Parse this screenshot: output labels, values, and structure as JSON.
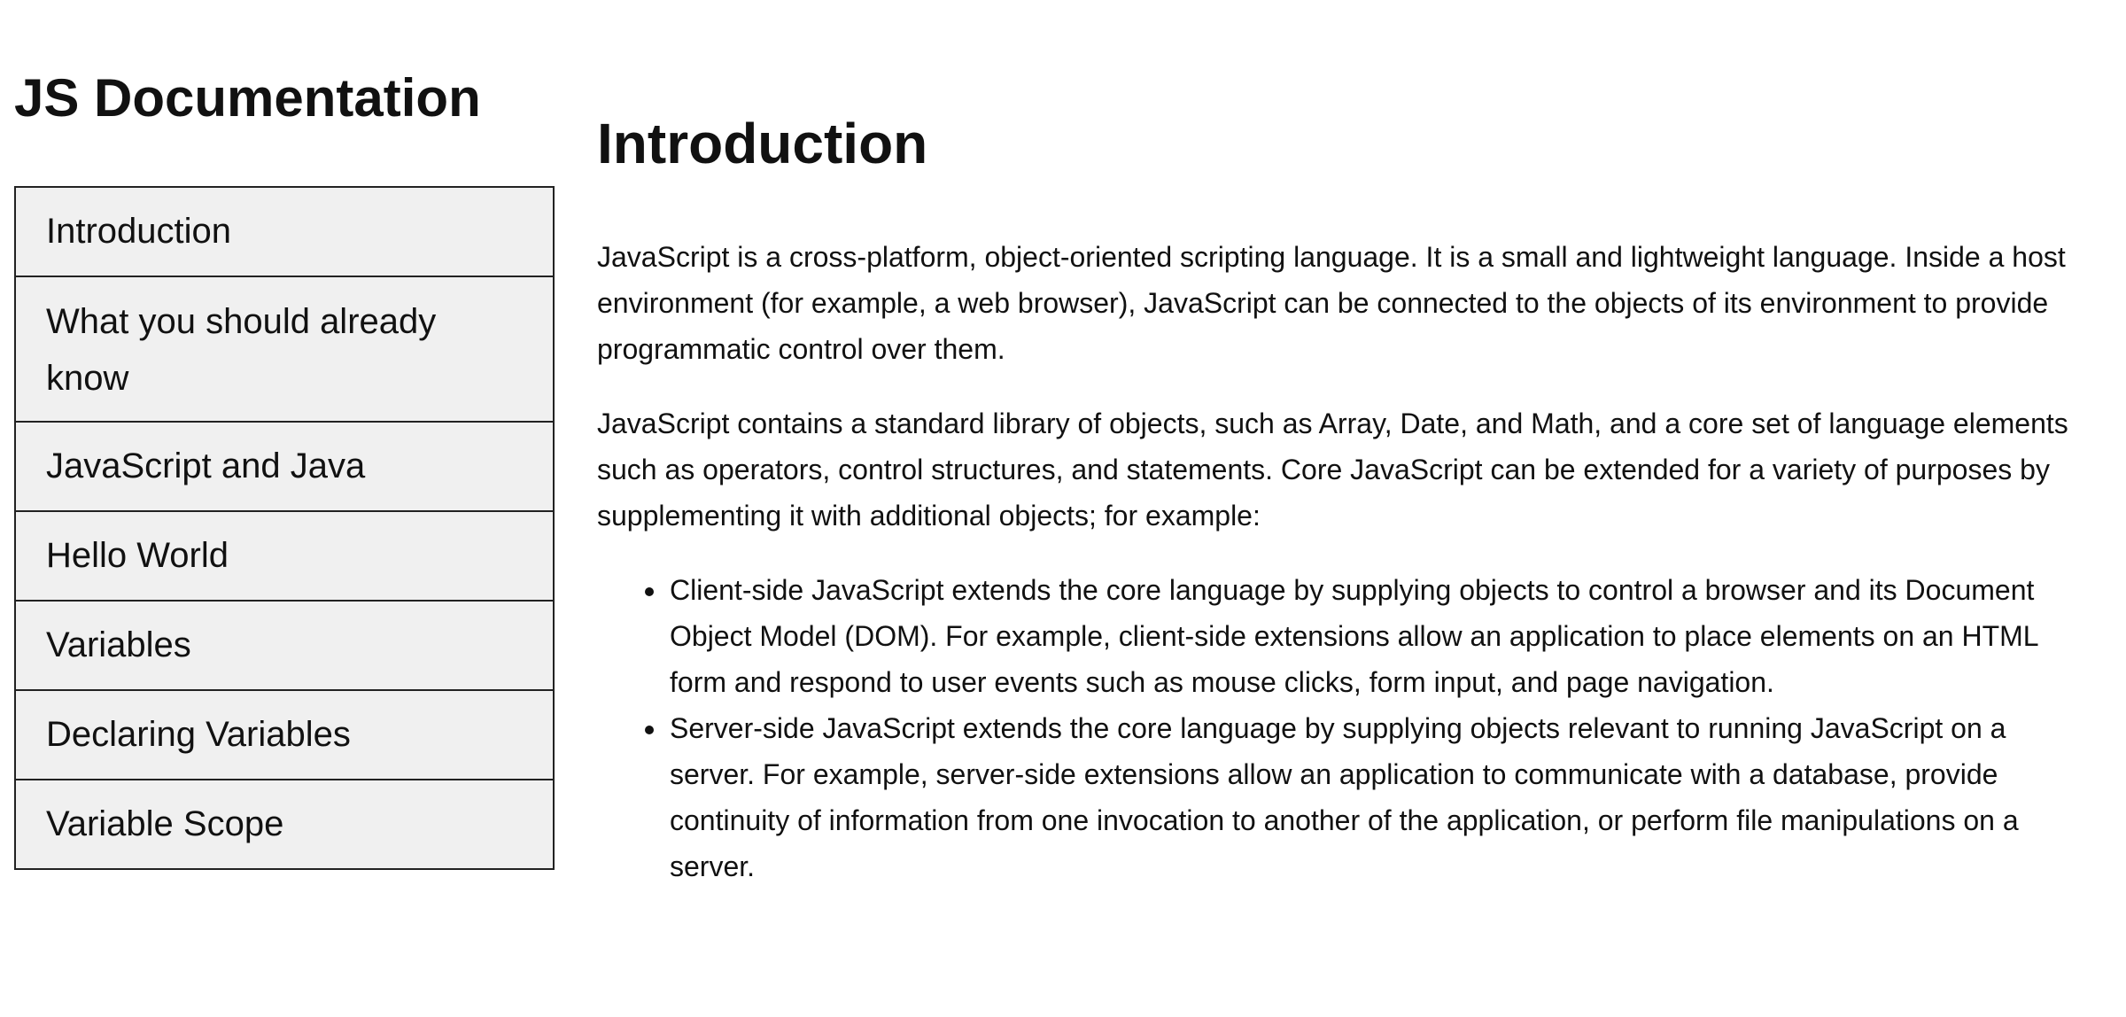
{
  "navbar": {
    "header": "JS Documentation",
    "items": [
      {
        "label": "Introduction"
      },
      {
        "label": "What you should already know"
      },
      {
        "label": "JavaScript and Java"
      },
      {
        "label": "Hello World"
      },
      {
        "label": "Variables"
      },
      {
        "label": "Declaring Variables"
      },
      {
        "label": "Variable Scope"
      }
    ]
  },
  "main": {
    "section_title": "Introduction",
    "paragraphs": [
      "JavaScript is a cross-platform, object-oriented scripting language. It is a small and lightweight language. Inside a host environment (for example, a web browser), JavaScript can be connected to the objects of its environment to provide programmatic control over them.",
      "JavaScript contains a standard library of objects, such as Array, Date, and Math, and a core set of language elements such as operators, control structures, and statements. Core JavaScript can be extended for a variety of purposes by supplementing it with additional objects; for example:"
    ],
    "bullets": [
      "Client-side JavaScript extends the core language by supplying objects to control a browser and its Document Object Model (DOM). For example, client-side extensions allow an application to place elements on an HTML form and respond to user events such as mouse clicks, form input, and page navigation.",
      "Server-side JavaScript extends the core language by supplying objects relevant to running JavaScript on a server. For example, server-side extensions allow an application to communicate with a database, provide continuity of information from one invocation to another of the application, or perform file manipulations on a server."
    ]
  }
}
